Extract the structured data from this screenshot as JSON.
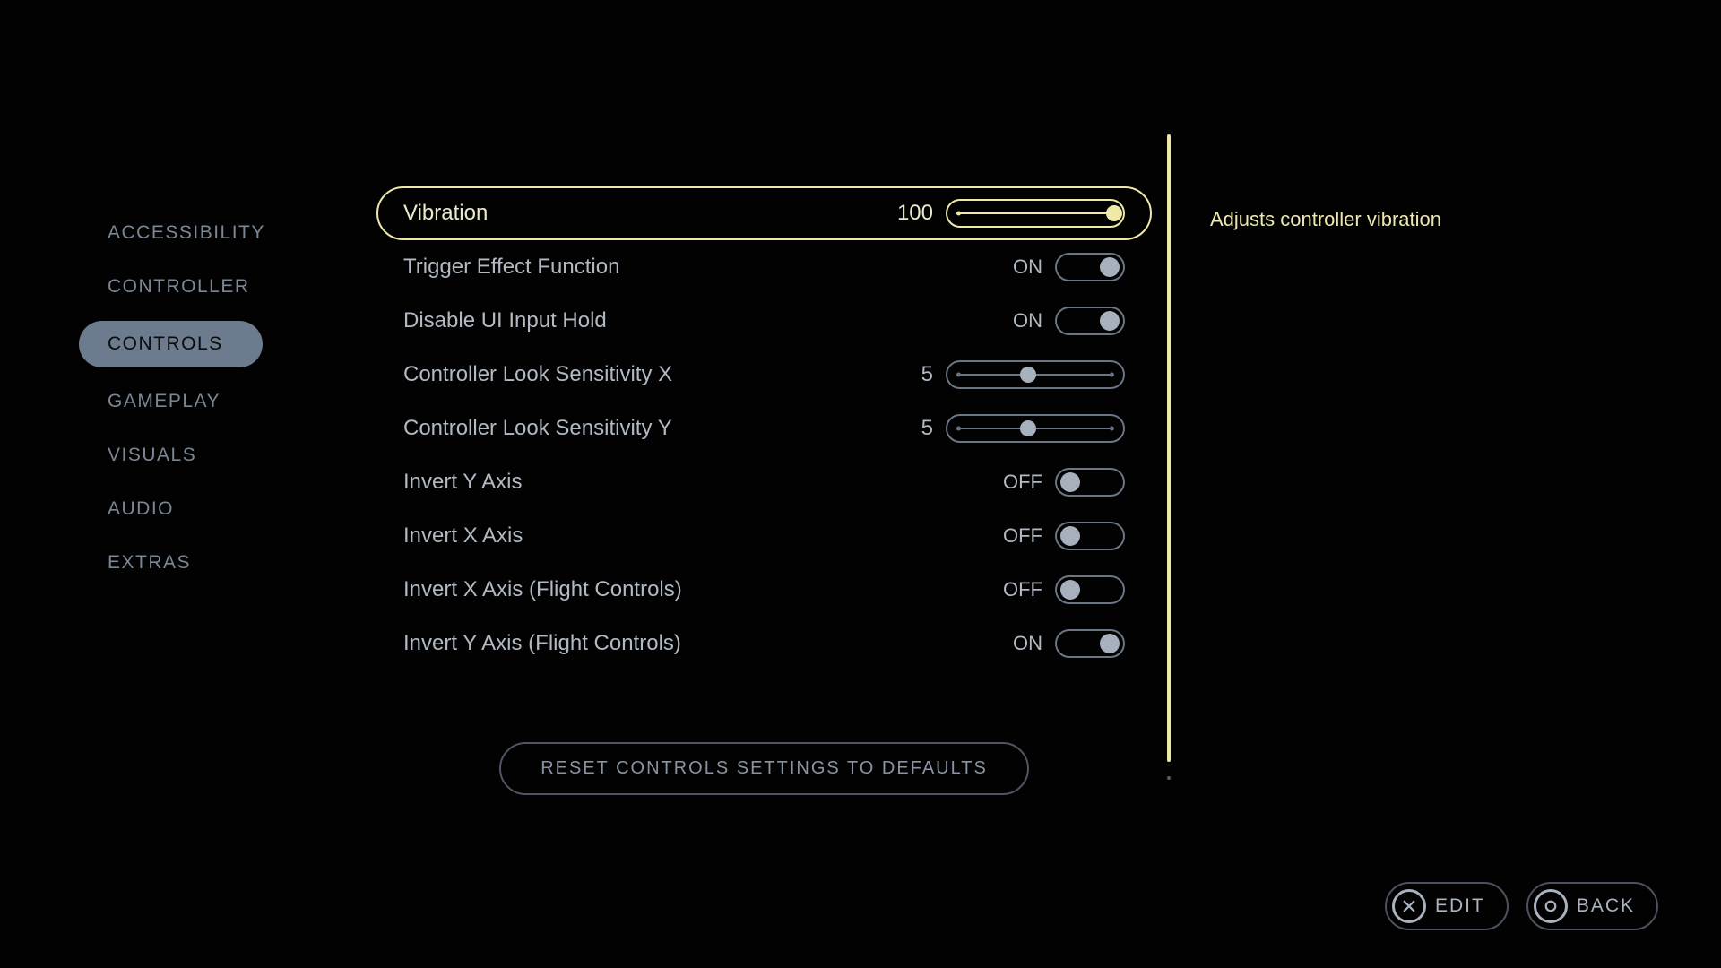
{
  "sidebar": {
    "items": [
      {
        "label": "ACCESSIBILITY",
        "key": "accessibility"
      },
      {
        "label": "CONTROLLER",
        "key": "controller"
      },
      {
        "label": "CONTROLS",
        "key": "controls"
      },
      {
        "label": "GAMEPLAY",
        "key": "gameplay"
      },
      {
        "label": "VISUALS",
        "key": "visuals"
      },
      {
        "label": "AUDIO",
        "key": "audio"
      },
      {
        "label": "EXTRAS",
        "key": "extras"
      }
    ],
    "active_index": 2
  },
  "description": "Adjusts controller vibration",
  "settings": {
    "highlight_index": 0,
    "rows": [
      {
        "label": "Vibration",
        "kind": "slider",
        "value": 100,
        "min": 0,
        "max": 100
      },
      {
        "label": "Trigger Effect Function",
        "kind": "toggle",
        "state": "ON"
      },
      {
        "label": "Disable UI Input Hold",
        "kind": "toggle",
        "state": "ON"
      },
      {
        "label": "Controller Look Sensitivity X",
        "kind": "slider",
        "value": 5,
        "min": 1,
        "max": 10
      },
      {
        "label": "Controller Look Sensitivity Y",
        "kind": "slider",
        "value": 5,
        "min": 1,
        "max": 10
      },
      {
        "label": "Invert Y Axis",
        "kind": "toggle",
        "state": "OFF"
      },
      {
        "label": "Invert X Axis",
        "kind": "toggle",
        "state": "OFF"
      },
      {
        "label": "Invert X Axis (Flight Controls)",
        "kind": "toggle",
        "state": "OFF"
      },
      {
        "label": "Invert Y Axis (Flight Controls)",
        "kind": "toggle",
        "state": "ON"
      }
    ]
  },
  "reset_label": "RESET CONTROLS SETTINGS TO DEFAULTS",
  "footer": {
    "edit": {
      "label": "EDIT"
    },
    "back": {
      "label": "BACK"
    }
  }
}
